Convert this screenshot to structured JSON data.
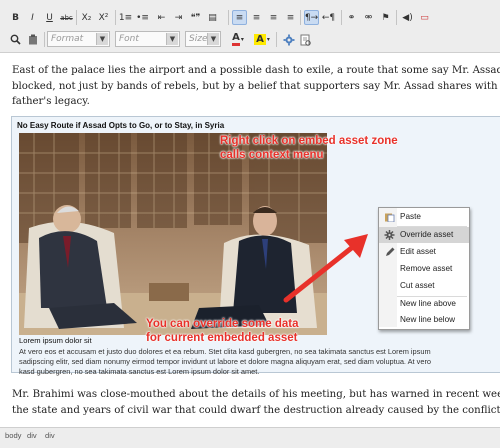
{
  "toolbar": {
    "row1": [
      {
        "name": "bold-button",
        "glyph": "B"
      },
      {
        "name": "italic-button",
        "glyph": "I"
      },
      {
        "name": "underline-button",
        "glyph": "U"
      },
      {
        "name": "strikethrough-button",
        "glyph": "abc"
      },
      {
        "name": "subscript-button",
        "glyph": "X₂"
      },
      {
        "name": "superscript-button",
        "glyph": "X²"
      },
      {
        "name": "numbered-list-button",
        "glyph": "1≡"
      },
      {
        "name": "bulleted-list-button",
        "glyph": "•≡"
      },
      {
        "name": "outdent-button",
        "glyph": "⇤"
      },
      {
        "name": "indent-button",
        "glyph": "⇥"
      },
      {
        "name": "blockquote-button",
        "glyph": "❝❞"
      },
      {
        "name": "div-button",
        "glyph": "▤"
      },
      {
        "name": "align-left-button",
        "glyph": "≡"
      },
      {
        "name": "align-center-button",
        "glyph": "≡"
      },
      {
        "name": "align-right-button",
        "glyph": "≡"
      },
      {
        "name": "justify-button",
        "glyph": "≡"
      },
      {
        "name": "ltr-button",
        "glyph": "¶→"
      },
      {
        "name": "rtl-button",
        "glyph": "←¶"
      },
      {
        "name": "link-button",
        "glyph": "⚭"
      },
      {
        "name": "unlink-button",
        "glyph": "⚮"
      },
      {
        "name": "anchor-button",
        "glyph": "⚑"
      },
      {
        "name": "media-button",
        "glyph": "◀)"
      },
      {
        "name": "special-button",
        "glyph": "▭"
      }
    ],
    "find_icon": "search-icon",
    "paste_icon": "clipboard-icon",
    "format_placeholder": "Format",
    "font_placeholder": "Font",
    "size_placeholder": "Size",
    "text_color_glyph": "A",
    "bg_color_glyph": "A",
    "maximize_icon": "gear-icon",
    "source_icon": "source-icon"
  },
  "article": {
    "para1": [
      "East of the palace lies the airport and a possible dash to exile, a route that some say Mr. Assad's mother ar",
      "blocked, not just by bands of rebels, but by a belief that supporters say Mr. Assad shares with his advisers t",
      "father's legacy."
    ],
    "para2": [
      "Mr. Brahimi was close-mouthed about the details of his meeting, but has warned in recent weeks that with",
      "the state and years of civil war that could dwarf the destruction already caused by the conflict that has tal"
    ]
  },
  "embed": {
    "title": "No Easy Route if Assad Opts to Go, or to Stay, in Syria",
    "caption": "Lorem ipsum dolor sit",
    "body": [
      "At vero eos et accusam et justo duo dolores et ea rebum. Stet clita kasd gubergren, no sea takimata sanctus est Lorem ipsum",
      "sadipscing elitr, sed diam nonumy eirmod tempor invidunt ut labore et dolore magna aliquyam erat, sed diam voluptua. At vero",
      "kasd gubergren, no sea takimata sanctus est Lorem ipsum dolor sit amet."
    ]
  },
  "annotations": {
    "top": [
      "Right click on embed asset zone",
      "calls context menu"
    ],
    "bottom": [
      "You can override some data",
      "for current embedded asset"
    ],
    "color": "#e8312a"
  },
  "context_menu": {
    "items": [
      {
        "label": "Paste",
        "icon": "paste-icon",
        "highlighted": false
      },
      {
        "label": "Override asset",
        "icon": "gear-icon",
        "highlighted": true
      },
      {
        "label": "Edit asset",
        "icon": "pencil-icon",
        "highlighted": false
      },
      {
        "label": "Remove asset",
        "icon": "",
        "highlighted": false
      },
      {
        "label": "Cut asset",
        "icon": "",
        "highlighted": false
      },
      {
        "label": "New line above",
        "icon": "",
        "highlighted": false
      },
      {
        "label": "New line below",
        "icon": "",
        "highlighted": false
      }
    ]
  },
  "statusbar": {
    "crumbs": [
      "body",
      "div",
      "div"
    ]
  }
}
